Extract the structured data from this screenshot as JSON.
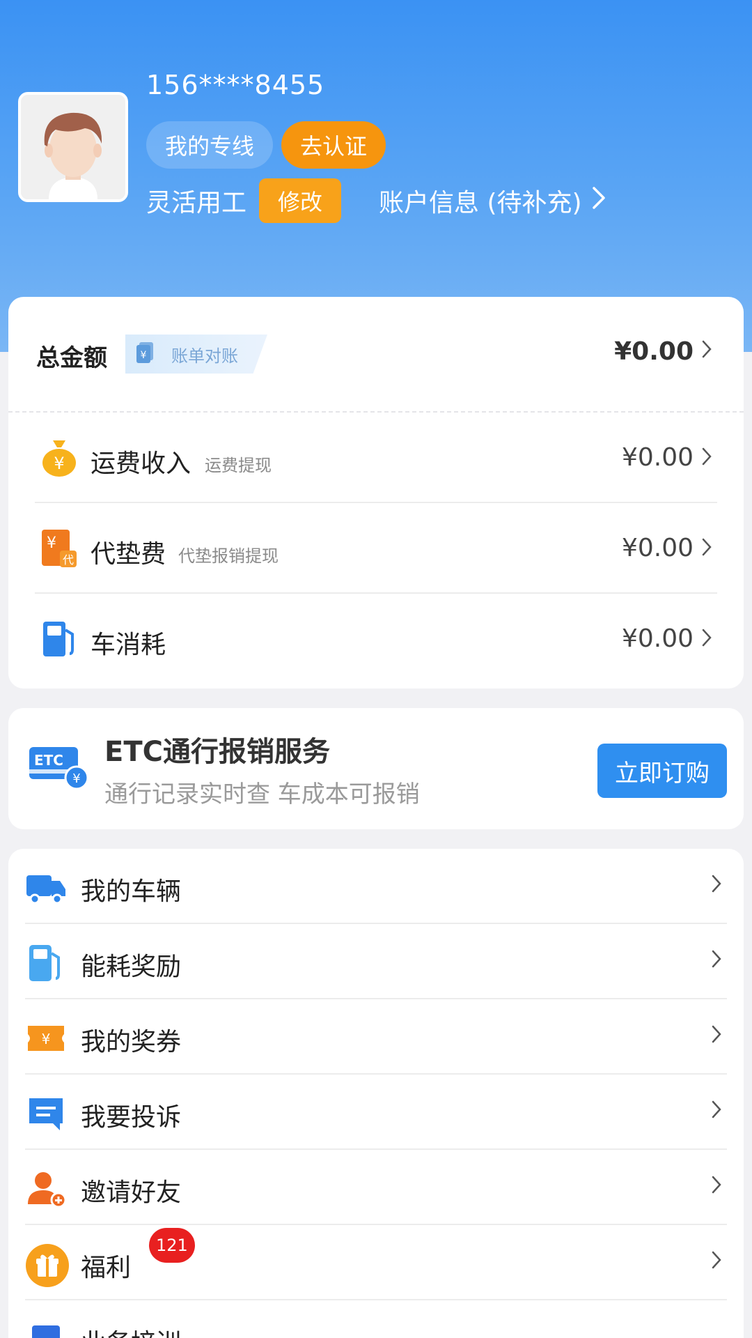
{
  "profile": {
    "phone": "156****8455",
    "my_line_label": "我的专线",
    "certify_label": "去认证",
    "role": "灵活用工",
    "edit_label": "修改",
    "account_info_label": "账户信息 (待补充)",
    "chevron": ">"
  },
  "totals": {
    "title": "总金额",
    "reconcile_label": "账单对账",
    "amount": "¥0.00"
  },
  "fees": [
    {
      "label": "运费收入",
      "sub": "运费提现",
      "amount": "¥0.00",
      "icon": "money-bag-icon",
      "color": "#f7b21c"
    },
    {
      "label": "代垫费",
      "sub": "代垫报销提现",
      "amount": "¥0.00",
      "icon": "advance-fee-icon",
      "color": "#f07a1e"
    },
    {
      "label": "车消耗",
      "sub": "",
      "amount": "¥0.00",
      "icon": "fuel-pump-icon",
      "color": "#2f86ea"
    }
  ],
  "etc": {
    "title": "ETC通行报销服务",
    "subtitle": "通行记录实时查 车成本可报销",
    "button": "立即订购",
    "icon": "etc-card-icon"
  },
  "menu": [
    {
      "label": "我的车辆",
      "icon": "truck-icon"
    },
    {
      "label": "能耗奖励",
      "icon": "fuel-reward-icon"
    },
    {
      "label": "我的奖券",
      "icon": "coupon-icon"
    },
    {
      "label": "我要投诉",
      "icon": "complaint-icon"
    },
    {
      "label": "邀请好友",
      "icon": "invite-friend-icon"
    },
    {
      "label": "福利",
      "icon": "gift-icon",
      "badge": "121"
    },
    {
      "label": "业务培训",
      "icon": "training-icon"
    }
  ],
  "colors": {
    "primary_blue": "#2f8ff0",
    "orange": "#f6950e",
    "badge_red": "#e82020"
  }
}
